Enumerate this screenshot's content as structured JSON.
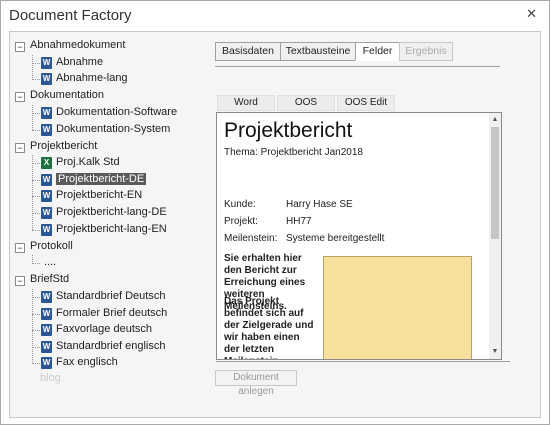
{
  "window": {
    "title": "Document Factory",
    "close_glyph": "✕"
  },
  "tree": {
    "groups": [
      {
        "label": "Abnahmedokument",
        "items": [
          {
            "label": "Abnahme",
            "icon": "word-icon"
          },
          {
            "label": "Abnahme-lang",
            "icon": "word-icon"
          }
        ]
      },
      {
        "label": "Dokumentation",
        "items": [
          {
            "label": "Dokumentation-Software",
            "icon": "word-icon"
          },
          {
            "label": "Dokumentation-System",
            "icon": "word-icon"
          }
        ]
      },
      {
        "label": "Projektbericht",
        "items": [
          {
            "label": "Proj.Kalk Std",
            "icon": "excel-icon"
          },
          {
            "label": "Projektbericht-DE",
            "icon": "word-icon",
            "selected": true
          },
          {
            "label": "Projektbericht-EN",
            "icon": "word-icon"
          },
          {
            "label": "Projektbericht-lang-DE",
            "icon": "word-icon"
          },
          {
            "label": "Projektbericht-lang-EN",
            "icon": "word-icon"
          }
        ]
      },
      {
        "label": "Protokoll",
        "items": [
          {
            "label": "....",
            "icon": ""
          }
        ]
      },
      {
        "label": "BriefStd",
        "items": [
          {
            "label": "Standardbrief Deutsch",
            "icon": "word-icon"
          },
          {
            "label": "Formaler Brief deutsch",
            "icon": "word-icon"
          },
          {
            "label": "Faxvorlage deutsch",
            "icon": "word-icon"
          },
          {
            "label": "Standardbrief englisch",
            "icon": "word-icon"
          },
          {
            "label": "Fax englisch",
            "icon": "word-icon"
          }
        ]
      }
    ],
    "collapse_glyph": "−",
    "watermark": "blog"
  },
  "tabs": [
    {
      "label": "Basisdaten"
    },
    {
      "label": "Textbausteine"
    },
    {
      "label": "Felder",
      "active": true
    },
    {
      "label": "Ergebnis",
      "disabled": true
    }
  ],
  "subtoolbar": {
    "word": "Word",
    "oos": "OOS",
    "oos_edit": "OOS Edit"
  },
  "preview": {
    "title": "Projektbericht",
    "subtitle": "Thema: Projektbericht Jan2018",
    "fields": [
      {
        "key": "Kunde:",
        "value": "Harry Hase SE"
      },
      {
        "key": "Projekt:",
        "value": "HH77"
      },
      {
        "key": "Meilenstein:",
        "value": "Systeme bereitgestellt"
      }
    ],
    "para1": "Sie erhalten hier den Bericht zur Erreichung eines weiteren Meilensteins.",
    "para2": "Das Projekt befindet sich auf der Zielgerade und wir haben einen der letzten Meilenstein erreicht",
    "accent_color": "#f7df9c"
  },
  "actions": {
    "create": "Dokument anlegen"
  },
  "colors": {
    "selection": "#5a5a5a",
    "word": "#2b5797",
    "excel": "#1e7145"
  }
}
